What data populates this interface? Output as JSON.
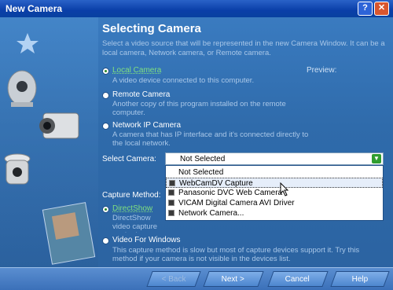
{
  "window": {
    "title": "New Camera",
    "help_glyph": "?",
    "close_glyph": "✕"
  },
  "heading": "Selecting Camera",
  "intro": "Select a video source that will be represented in the new Camera Window. It can be a local camera, Network camera, or Remote camera.",
  "preview_label": "Preview:",
  "source_options": [
    {
      "label": "Local Camera",
      "desc": "A video device connected to this computer.",
      "selected": true
    },
    {
      "label": "Remote Camera",
      "desc": "Another copy of this program installed on the remote computer.",
      "selected": false
    },
    {
      "label": "Network IP Camera",
      "desc": "A camera that has IP interface and it's connected directly to the local network.",
      "selected": false
    }
  ],
  "select_camera": {
    "label": "Select Camera:",
    "value": "Not Selected",
    "items": [
      "Not Selected",
      "WebCamDV Capture",
      "Panasonic DVC Web Camera",
      "VICAM Digital Camera AVI Driver",
      "Network Camera..."
    ],
    "highlighted_index": 1
  },
  "capture_method": {
    "label": "Capture Method:",
    "options": [
      {
        "label": "DirectShow",
        "desc": "DirectShow video capture method ... direct access to the video hardware.",
        "selected": true
      },
      {
        "label": "Video For Windows",
        "desc": "This capture method is slow but most of capture devices support it. Try this method if your camera is not visible in the devices list.",
        "selected": false
      }
    ]
  },
  "buttons": {
    "back": "< Back",
    "next": "Next >",
    "cancel": "Cancel",
    "help": "Help"
  },
  "colors": {
    "accent": "#2f6fb0",
    "selected_text": "#7fe07f"
  }
}
